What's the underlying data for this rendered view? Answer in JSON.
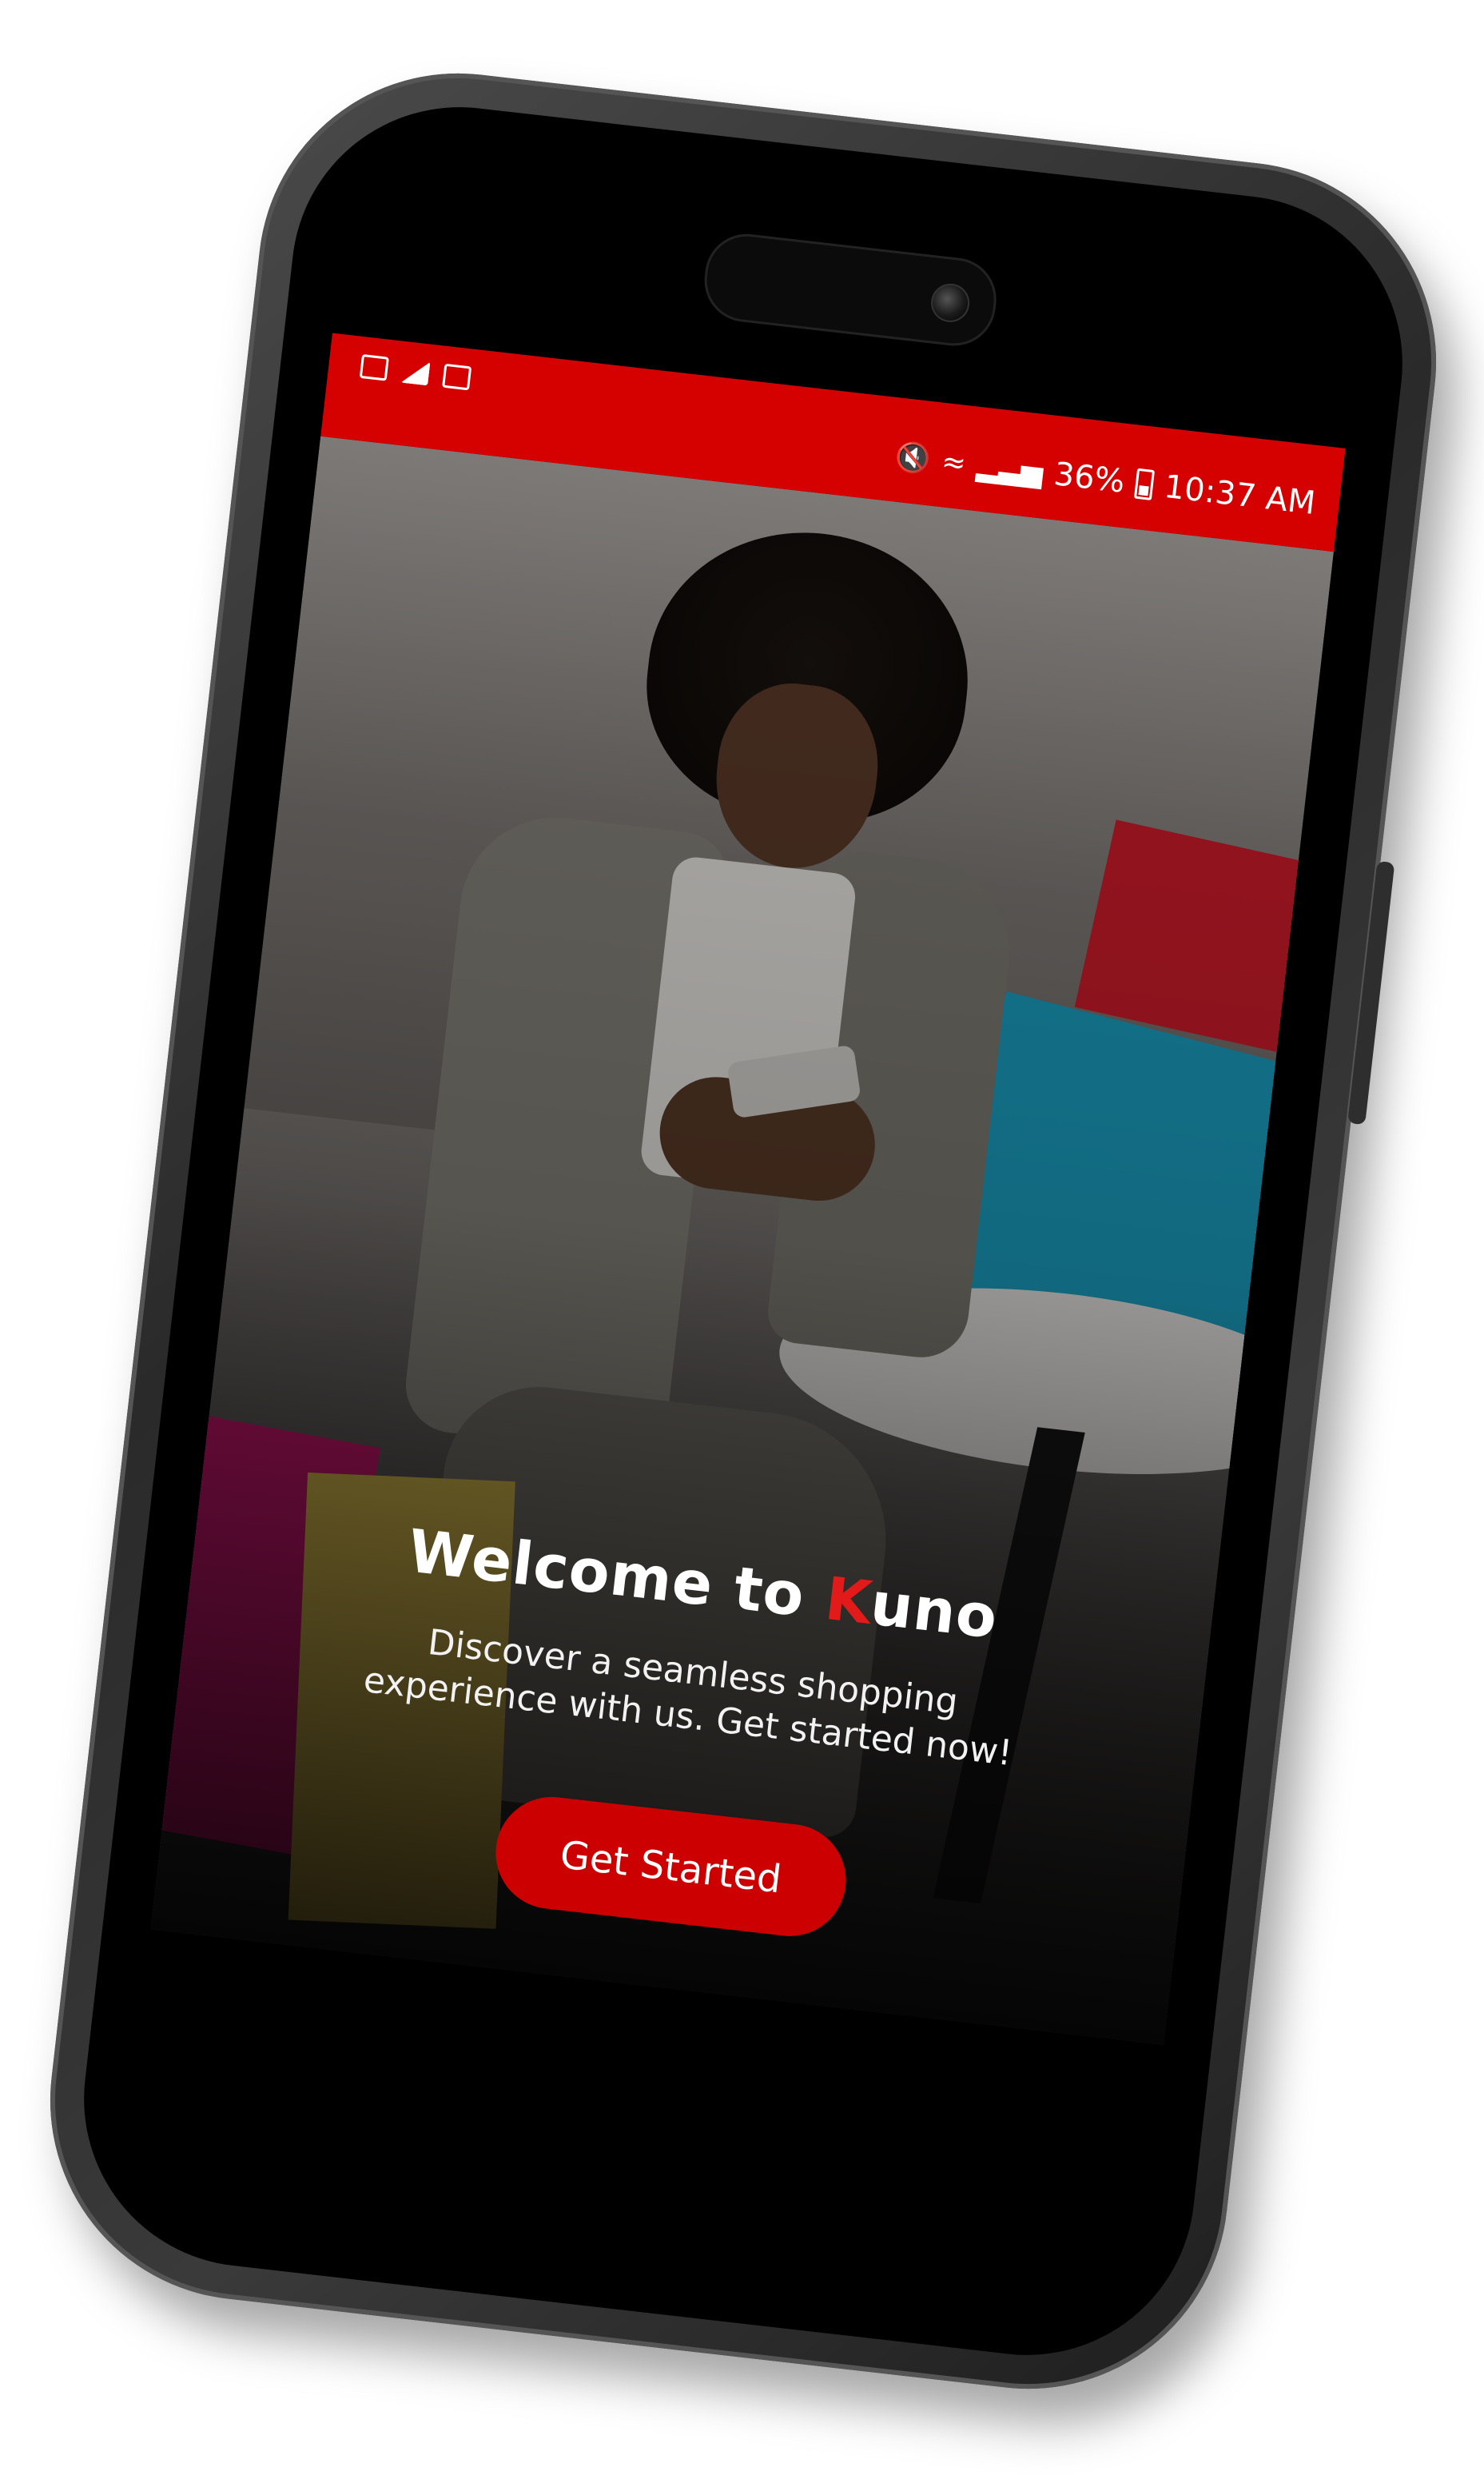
{
  "status_bar": {
    "mute_icon": "mute-icon",
    "wifi_icon": "wifi-icon",
    "signal_icon": "signal-icon",
    "battery_percent": "36%",
    "battery_icon": "battery-icon",
    "time": "10:37 AM",
    "left_icons": [
      "image-icon",
      "telegram-icon",
      "calendar-icon"
    ],
    "background_color": "#d50000"
  },
  "welcome": {
    "title_prefix": "Welcome to ",
    "brand_first_letter": "K",
    "brand_rest": "uno",
    "subtitle": "Discover a seamless shopping experience with us. Get started now!",
    "cta_label": "Get Started",
    "cta_color": "#cc0000",
    "brand_accent_color": "#e21a1a"
  }
}
